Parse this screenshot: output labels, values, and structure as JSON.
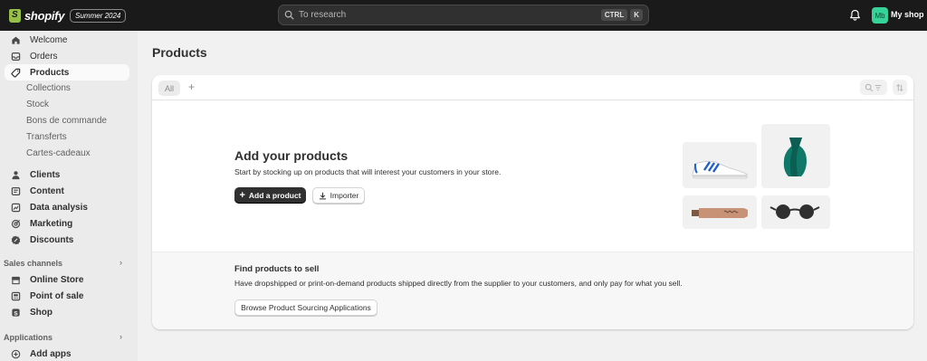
{
  "topbar": {
    "logo_text": "shopify",
    "edition": "Summer 2024",
    "search_placeholder": "To research",
    "shortcut_keys": [
      "CTRL",
      "K"
    ],
    "avatar_initials": "Mb",
    "shop_name": "My shop"
  },
  "sidebar": {
    "primary": [
      {
        "label": "Welcome",
        "icon": "home-icon"
      },
      {
        "label": "Orders",
        "icon": "inbox-icon"
      },
      {
        "label": "Products",
        "icon": "tag-icon",
        "active": true
      }
    ],
    "product_sub": [
      "Collections",
      "Stock",
      "Bons de commande",
      "Transferts",
      "Cartes-cadeaux"
    ],
    "secondary": [
      {
        "label": "Clients",
        "icon": "person-icon"
      },
      {
        "label": "Content",
        "icon": "content-icon"
      },
      {
        "label": "Data analysis",
        "icon": "chart-icon"
      },
      {
        "label": "Marketing",
        "icon": "target-icon"
      },
      {
        "label": "Discounts",
        "icon": "discount-icon"
      }
    ],
    "sales_channels_title": "Sales channels",
    "sales_channels": [
      {
        "label": "Online Store",
        "icon": "store-icon"
      },
      {
        "label": "Point of sale",
        "icon": "pos-icon"
      },
      {
        "label": "Shop",
        "icon": "shop-bag-icon"
      }
    ],
    "applications_title": "Applications",
    "add_apps": "Add apps"
  },
  "main": {
    "title": "Products",
    "tabs": [
      "All"
    ],
    "empty": {
      "title": "Add your products",
      "description": "Start by stocking up on products that will interest your customers in your store.",
      "primary_button": "Add a product",
      "secondary_button": "Importer"
    },
    "find": {
      "title": "Find products to sell",
      "description": "Have dropshipped or print-on-demand products shipped directly from the supplier to your customers, and only pay for what you sell.",
      "button": "Browse Product Sourcing Applications"
    }
  },
  "colors": {
    "topbar": "#1a1a1a",
    "brand_green": "#95bf47",
    "avatar": "#36d399",
    "primary_button": "#303030"
  }
}
